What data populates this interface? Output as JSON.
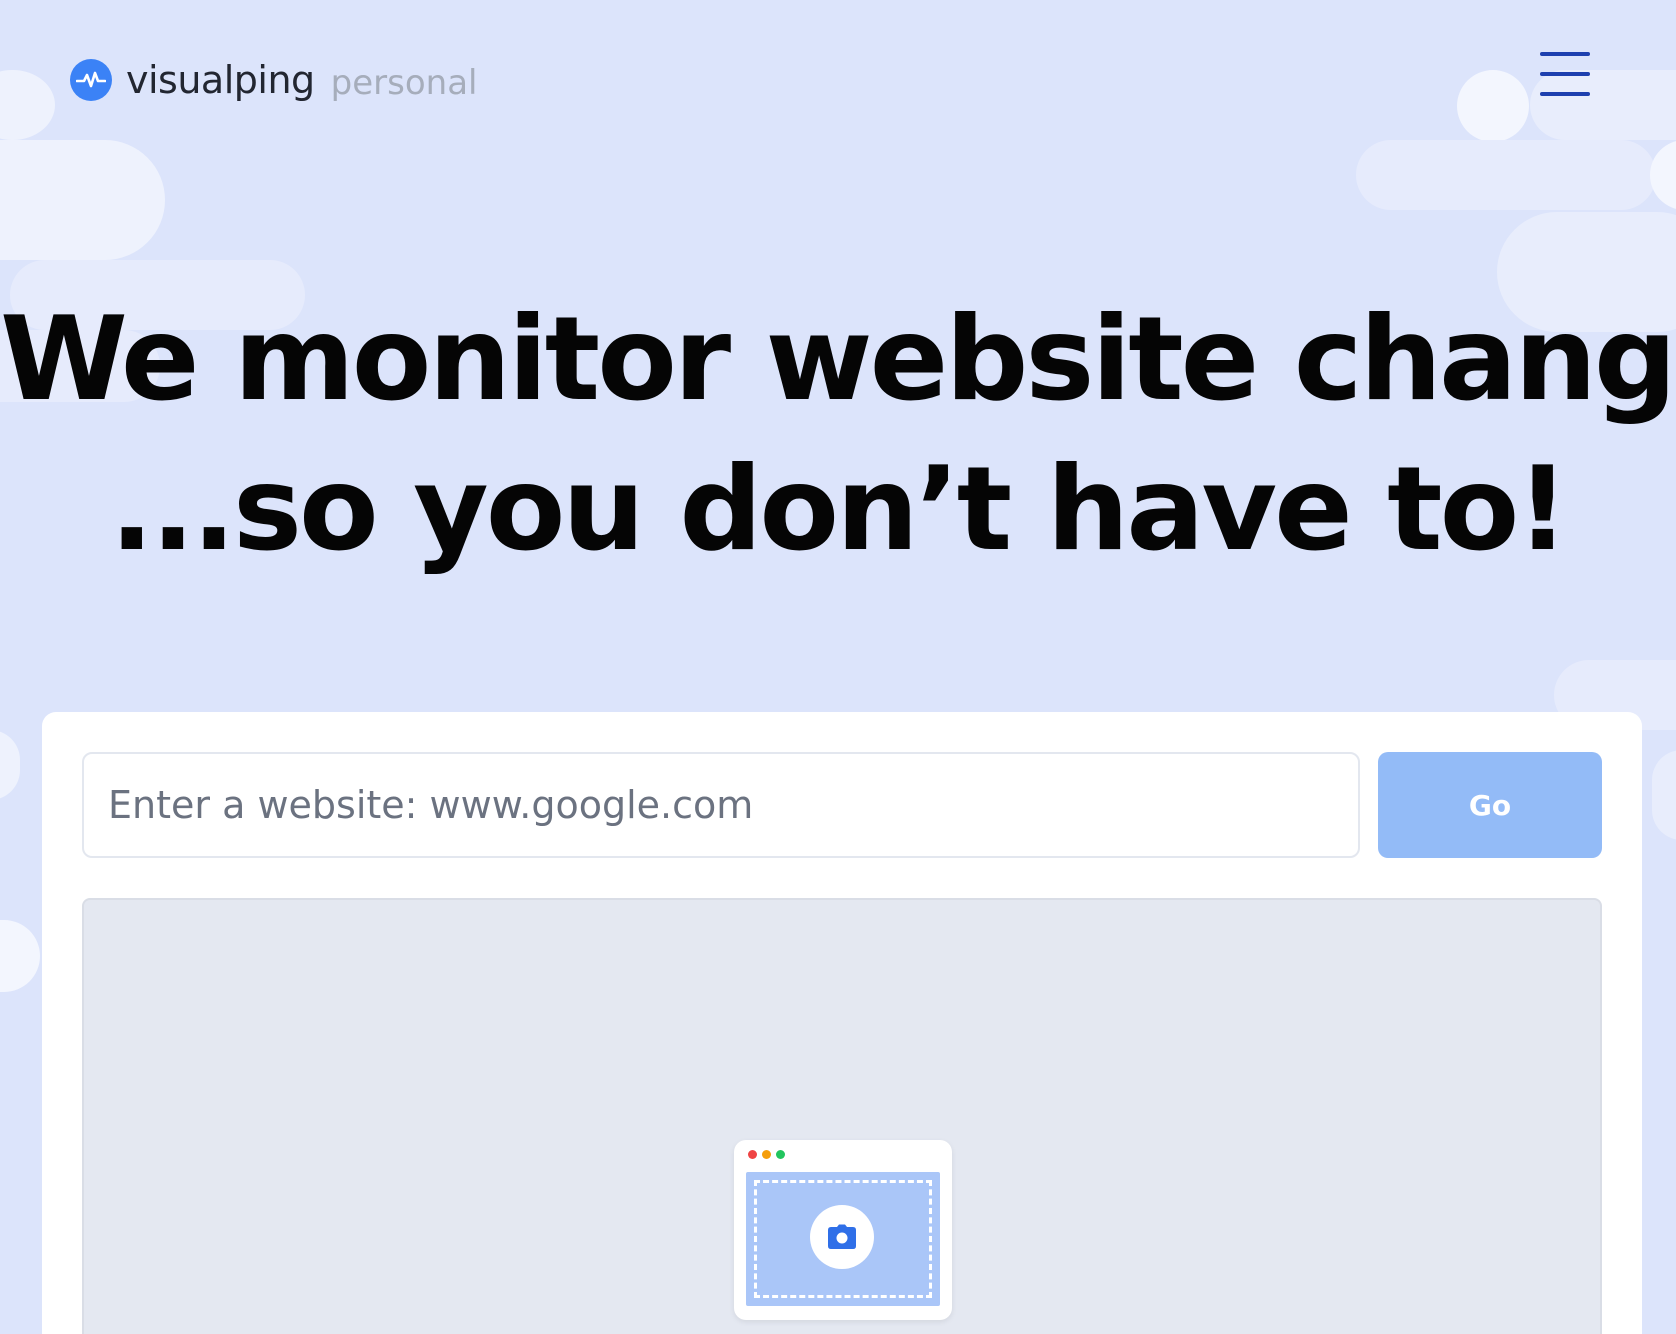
{
  "header": {
    "logo_name": "visualping",
    "logo_suffix": "personal",
    "logo_icon": "pulse-icon",
    "menu_icon": "hamburger-menu-icon"
  },
  "hero": {
    "line1": "We monitor website changes",
    "line2": "...so you don’t have to!"
  },
  "search": {
    "placeholder": "Enter a website: www.google.com",
    "value": "",
    "go_label": "Go"
  },
  "preview": {
    "illustration_icon": "camera-icon"
  },
  "colors": {
    "background": "#dce4fb",
    "accent": "#3b82f6",
    "go_button": "#93bbf7",
    "preview_bg": "#e4e8f1"
  }
}
